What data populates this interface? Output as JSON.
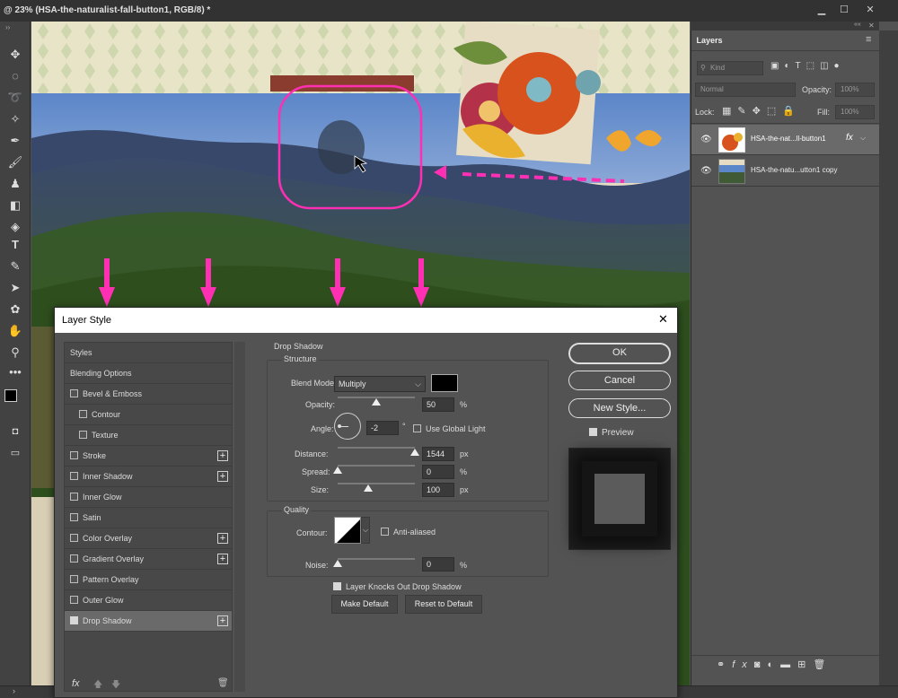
{
  "document": {
    "title": "@ 23% (HSA-the-naturalist-fall-button1, RGB/8) *"
  },
  "window": {
    "minimize": "▁",
    "maximize": "☐",
    "close": "✕"
  },
  "tools": {
    "collapse": "››",
    "text_tool": "T"
  },
  "layers_panel": {
    "tab_label": "Layers",
    "collapse": "««",
    "close": "✕",
    "menu_icon": "≡",
    "filter_kind": "Kind",
    "blend_mode": "Normal",
    "opacity_label": "Opacity:",
    "opacity_value": "100%",
    "lock_label": "Lock:",
    "fill_label": "Fill:",
    "fill_value": "100%",
    "layers": [
      {
        "name": "HSA-the-nat...ll-button1",
        "fx": "fx",
        "selected": true
      },
      {
        "name": "HSA-the-natu...utton1 copy",
        "selected": false
      }
    ]
  },
  "dialog": {
    "title": "Layer Style",
    "close": "✕",
    "styles": [
      {
        "label": "Styles",
        "checkbox": false,
        "indent": false,
        "plus": false
      },
      {
        "label": "Blending Options",
        "checkbox": false,
        "indent": false,
        "plus": false
      },
      {
        "label": "Bevel & Emboss",
        "checkbox": true,
        "checked": false,
        "indent": false,
        "plus": false
      },
      {
        "label": "Contour",
        "checkbox": true,
        "checked": false,
        "indent": true,
        "plus": false
      },
      {
        "label": "Texture",
        "checkbox": true,
        "checked": false,
        "indent": true,
        "plus": false
      },
      {
        "label": "Stroke",
        "checkbox": true,
        "checked": false,
        "indent": false,
        "plus": true
      },
      {
        "label": "Inner Shadow",
        "checkbox": true,
        "checked": false,
        "indent": false,
        "plus": true
      },
      {
        "label": "Inner Glow",
        "checkbox": true,
        "checked": false,
        "indent": false,
        "plus": false
      },
      {
        "label": "Satin",
        "checkbox": true,
        "checked": false,
        "indent": false,
        "plus": false
      },
      {
        "label": "Color Overlay",
        "checkbox": true,
        "checked": false,
        "indent": false,
        "plus": true
      },
      {
        "label": "Gradient Overlay",
        "checkbox": true,
        "checked": false,
        "indent": false,
        "plus": true
      },
      {
        "label": "Pattern Overlay",
        "checkbox": true,
        "checked": false,
        "indent": false,
        "plus": false
      },
      {
        "label": "Outer Glow",
        "checkbox": true,
        "checked": false,
        "indent": false,
        "plus": false
      },
      {
        "label": "Drop Shadow",
        "checkbox": true,
        "checked": true,
        "indent": false,
        "plus": true,
        "selected": true
      }
    ],
    "plus_glyph": "+",
    "footer_fx": "fx",
    "drop_shadow": {
      "heading": "Drop Shadow",
      "structure": "Structure",
      "blend_mode_label": "Blend Mode:",
      "blend_mode": "Multiply",
      "shadow_color": "#000000",
      "opacity_label": "Opacity:",
      "opacity": "50",
      "opacity_level": 0.5,
      "angle_label": "Angle:",
      "angle": "-2",
      "degree": "°",
      "global_light_label": "Use Global Light",
      "global_light": false,
      "distance_label": "Distance:",
      "distance": "1544",
      "distance_level": 1.0,
      "spread_label": "Spread:",
      "spread": "0",
      "spread_level": 0.0,
      "size_label": "Size:",
      "size": "100",
      "size_level": 0.4,
      "unit_percent": "%",
      "unit_px": "px",
      "quality": "Quality",
      "contour_label": "Contour:",
      "anti_aliased_label": "Anti-aliased",
      "noise_label": "Noise:",
      "noise": "0",
      "noise_level": 0.0,
      "knockout_label": "Layer Knocks Out Drop Shadow",
      "knockout": true,
      "make_default": "Make Default",
      "reset_default": "Reset to Default"
    },
    "buttons": {
      "ok": "OK",
      "cancel": "Cancel",
      "new_style": "New Style..."
    },
    "preview_label": "Preview",
    "preview_checked": true
  },
  "colors": {
    "annotation": "#ff2fb4",
    "panel": "#535353",
    "sky": "#5b86c9"
  }
}
